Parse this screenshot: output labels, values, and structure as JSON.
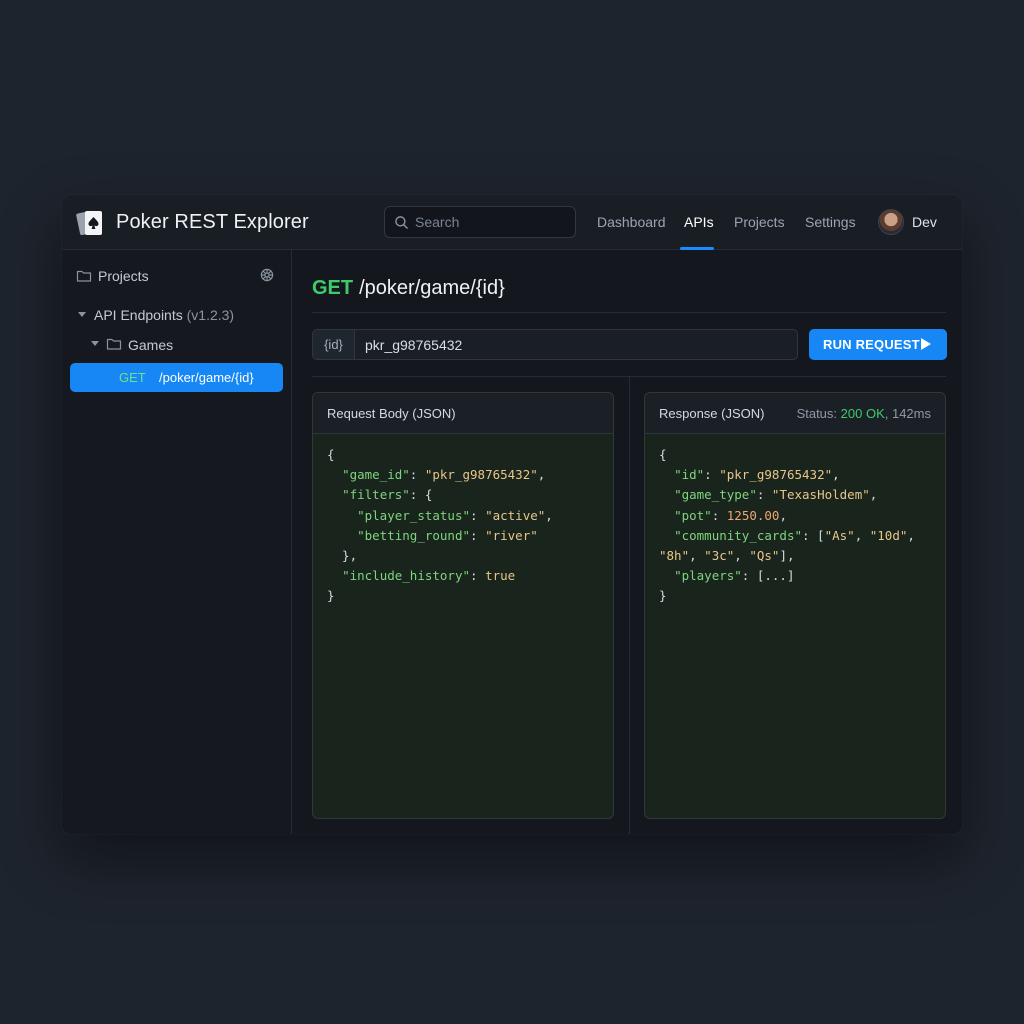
{
  "app": {
    "title": "Poker REST Explorer",
    "user": "Dev"
  },
  "search": {
    "placeholder": "Search"
  },
  "nav": {
    "items": [
      {
        "label": "Dashboard",
        "active": false
      },
      {
        "label": "APIs",
        "active": true
      },
      {
        "label": "Projects",
        "active": false
      },
      {
        "label": "Settings",
        "active": false
      }
    ]
  },
  "sidebar": {
    "header": "Projects",
    "tree": {
      "root": "API Endpoints",
      "version": "(v1.2.3)",
      "folder": "Games",
      "selected": {
        "method": "GET",
        "path": "/poker/game/{id}"
      }
    }
  },
  "endpoint": {
    "method": "GET",
    "path": "/poker/game/{id}"
  },
  "param": {
    "key": "{id}",
    "value": "pkr_g98765432"
  },
  "run_button": {
    "label": "RUN REQUEST"
  },
  "request_panel": {
    "title": "Request Body (JSON)",
    "lines": [
      [
        {
          "t": "p",
          "v": "{"
        }
      ],
      [
        {
          "t": "p",
          "v": "  "
        },
        {
          "t": "k",
          "v": "\"game_id\""
        },
        {
          "t": "p",
          "v": ": "
        },
        {
          "t": "s",
          "v": "\"pkr_g98765432\""
        },
        {
          "t": "p",
          "v": ","
        }
      ],
      [
        {
          "t": "p",
          "v": "  "
        },
        {
          "t": "k",
          "v": "\"filters\""
        },
        {
          "t": "p",
          "v": ": {"
        }
      ],
      [
        {
          "t": "p",
          "v": "    "
        },
        {
          "t": "k",
          "v": "\"player_status\""
        },
        {
          "t": "p",
          "v": ": "
        },
        {
          "t": "s",
          "v": "\"active\""
        },
        {
          "t": "p",
          "v": ","
        }
      ],
      [
        {
          "t": "p",
          "v": "    "
        },
        {
          "t": "k",
          "v": "\"betting_round\""
        },
        {
          "t": "p",
          "v": ": "
        },
        {
          "t": "s",
          "v": "\"river\""
        }
      ],
      [
        {
          "t": "p",
          "v": "  },"
        }
      ],
      [
        {
          "t": "p",
          "v": "  "
        },
        {
          "t": "k",
          "v": "\"include_history\""
        },
        {
          "t": "p",
          "v": ": "
        },
        {
          "t": "b",
          "v": "true"
        }
      ],
      [
        {
          "t": "p",
          "v": "}"
        }
      ]
    ]
  },
  "response_panel": {
    "title": "Response (JSON)",
    "status_label": "Status:",
    "status_code": "200 OK",
    "status_time": ", 142ms",
    "lines": [
      [
        {
          "t": "p",
          "v": "{"
        }
      ],
      [
        {
          "t": "p",
          "v": "  "
        },
        {
          "t": "k",
          "v": "\"id\""
        },
        {
          "t": "p",
          "v": ": "
        },
        {
          "t": "s",
          "v": "\"pkr_g98765432\""
        },
        {
          "t": "p",
          "v": ","
        }
      ],
      [
        {
          "t": "p",
          "v": "  "
        },
        {
          "t": "k",
          "v": "\"game_type\""
        },
        {
          "t": "p",
          "v": ": "
        },
        {
          "t": "s",
          "v": "\"TexasHoldem\""
        },
        {
          "t": "p",
          "v": ","
        }
      ],
      [
        {
          "t": "p",
          "v": "  "
        },
        {
          "t": "k",
          "v": "\"pot\""
        },
        {
          "t": "p",
          "v": ": "
        },
        {
          "t": "n",
          "v": "1250.00"
        },
        {
          "t": "p",
          "v": ","
        }
      ],
      [
        {
          "t": "p",
          "v": "  "
        },
        {
          "t": "k",
          "v": "\"community_cards\""
        },
        {
          "t": "p",
          "v": ": ["
        },
        {
          "t": "s",
          "v": "\"As\""
        },
        {
          "t": "p",
          "v": ", "
        },
        {
          "t": "s",
          "v": "\"10d\""
        },
        {
          "t": "p",
          "v": ","
        }
      ],
      [
        {
          "t": "s",
          "v": "\"8h\""
        },
        {
          "t": "p",
          "v": ", "
        },
        {
          "t": "s",
          "v": "\"3c\""
        },
        {
          "t": "p",
          "v": ", "
        },
        {
          "t": "s",
          "v": "\"Qs\""
        },
        {
          "t": "p",
          "v": "],"
        }
      ],
      [
        {
          "t": "p",
          "v": "  "
        },
        {
          "t": "k",
          "v": "\"players\""
        },
        {
          "t": "p",
          "v": ": [...]"
        }
      ],
      [
        {
          "t": "p",
          "v": "}"
        }
      ]
    ]
  },
  "colors": {
    "accent": "#1687f5",
    "method_get": "#3ecb6a",
    "json_key": "#7fd47f",
    "json_string": "#e8c68a",
    "json_number": "#f2a571"
  }
}
